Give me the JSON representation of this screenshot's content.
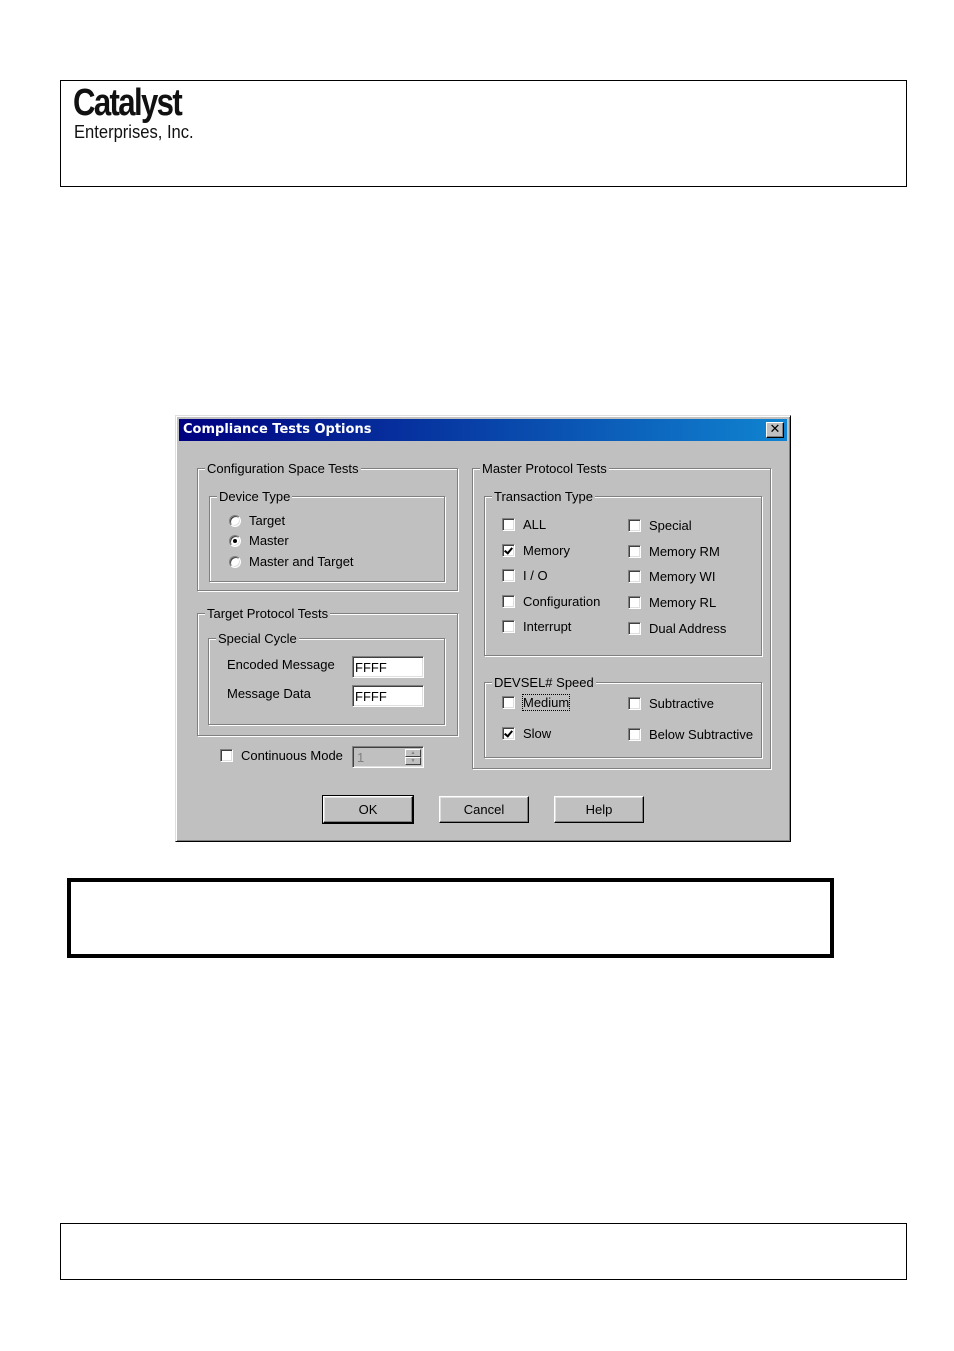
{
  "header": {
    "logo_main": "Catalyst",
    "logo_sub": "Enterprises, Inc."
  },
  "dialog": {
    "title": "Compliance Tests Options",
    "close_icon": "close-icon",
    "close_glyph": "✕",
    "config_space": {
      "label": "Configuration Space Tests",
      "device_type": {
        "label": "Device Type",
        "options": [
          {
            "label": "Target",
            "selected": false
          },
          {
            "label": "Master",
            "selected": true
          },
          {
            "label": "Master and Target",
            "selected": false
          }
        ]
      }
    },
    "target_protocol": {
      "label": "Target Protocol Tests",
      "special_cycle": {
        "label": "Special Cycle",
        "encoded_message_label": "Encoded Message",
        "encoded_message_value": "FFFF",
        "message_data_label": "Message Data",
        "message_data_value": "FFFF"
      }
    },
    "continuous_mode": {
      "label": "Continuous Mode",
      "checked": false,
      "spinner_value": "1",
      "spinner_enabled": false,
      "up_glyph": "▲",
      "down_glyph": "▼"
    },
    "master_protocol": {
      "label": "Master Protocol Tests",
      "transaction_type": {
        "label": "Transaction Type",
        "left": [
          {
            "label": "ALL",
            "checked": false
          },
          {
            "label": "Memory",
            "checked": true
          },
          {
            "label": "I / O",
            "checked": false
          },
          {
            "label": "Configuration",
            "checked": false
          },
          {
            "label": "Interrupt",
            "checked": false
          }
        ],
        "right": [
          {
            "label": "Special",
            "checked": false
          },
          {
            "label": "Memory RM",
            "checked": false
          },
          {
            "label": "Memory WI",
            "checked": false
          },
          {
            "label": "Memory RL",
            "checked": false
          },
          {
            "label": "Dual Address",
            "checked": false
          }
        ]
      },
      "devsel_speed": {
        "label": "DEVSEL# Speed",
        "options": [
          {
            "label": "Medium",
            "checked": false,
            "focused": true
          },
          {
            "label": "Subtractive",
            "checked": false
          },
          {
            "label": "Slow",
            "checked": true
          },
          {
            "label": "Below Subtractive",
            "checked": false
          }
        ]
      }
    },
    "buttons": {
      "ok": "OK",
      "cancel": "Cancel",
      "help": "Help"
    }
  }
}
